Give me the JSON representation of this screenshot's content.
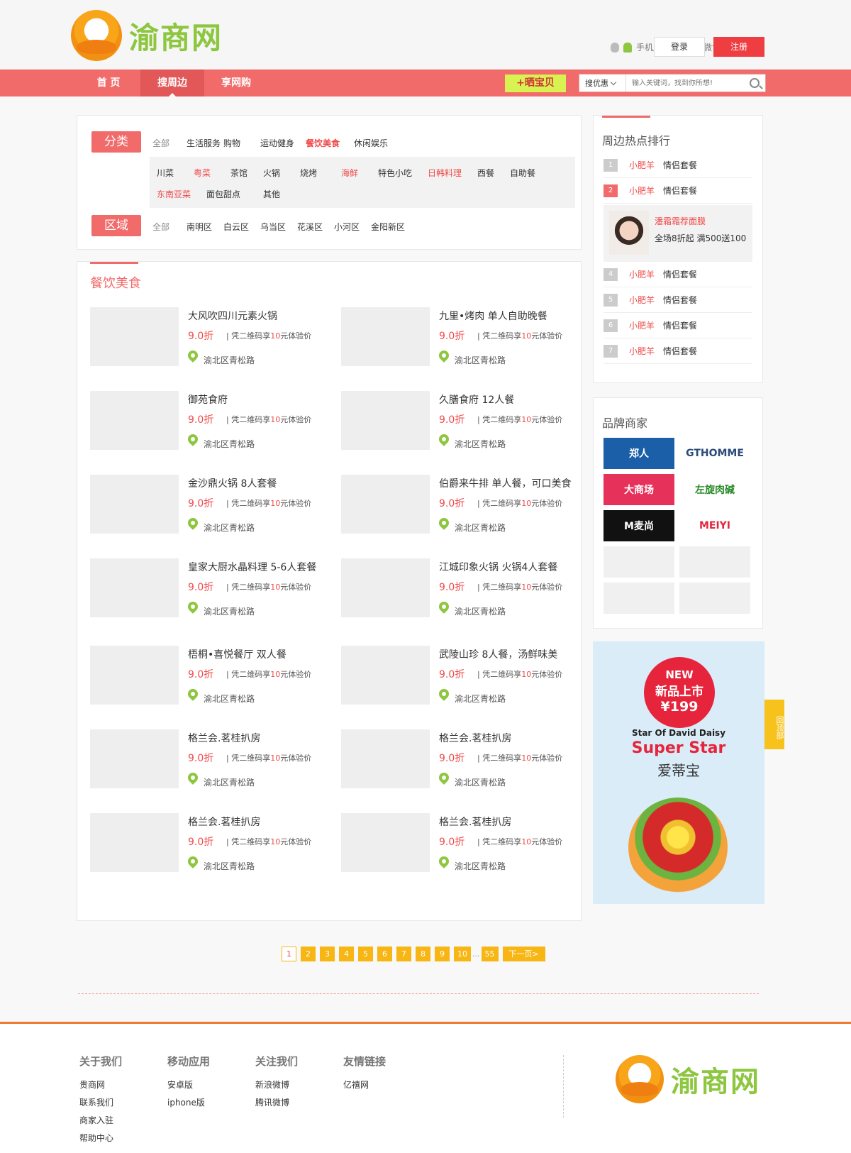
{
  "header": {
    "logo_text": "渝商网",
    "mobile_label": "手机版",
    "weibo_label": "微博登录",
    "login": "登录",
    "register": "注册"
  },
  "nav": {
    "items": [
      "首 页",
      "搜周边",
      "享网购"
    ],
    "active_index": 1,
    "add_button": "+晒宝贝",
    "search_select": "搜优惠",
    "search_placeholder": "输入关键词，找到你所想!"
  },
  "filter": {
    "category_tag": "分类",
    "categories": [
      "全部",
      "生活服务",
      "购物",
      "运动健身",
      "餐饮美食",
      "休闲娱乐"
    ],
    "active_category": "餐饮美食",
    "subcategories_row1": [
      "川菜",
      "粤菜",
      "茶馆",
      "火锅",
      "烧烤",
      "海鲜",
      "特色小吃",
      "日韩料理",
      "西餐",
      "自助餐"
    ],
    "subcategories_row2": [
      "东南亚菜",
      "面包甜点",
      "其他"
    ],
    "highlighted_subs": [
      "粤菜",
      "海鲜",
      "日韩料理",
      "东南亚菜"
    ],
    "region_tag": "区域",
    "regions": [
      "全部",
      "南明区",
      "白云区",
      "乌当区",
      "花溪区",
      "小河区",
      "金阳新区"
    ]
  },
  "deals": {
    "title": "餐饮美食",
    "price": "9.0折",
    "desc_prefix": "| 凭二维码享",
    "desc_num": "10",
    "desc_suffix": "元体验价",
    "location": "渝北区青松路",
    "items": [
      {
        "name": "大风吹四川元素火锅",
        "img": "bbq"
      },
      {
        "name": "九里•烤肉 单人自助晚餐",
        "img": "drink"
      },
      {
        "name": "御苑食府",
        "img": "meat"
      },
      {
        "name": "久膳食府 12人餐",
        "img": "corn"
      },
      {
        "name": "金沙鼎火锅 8人套餐",
        "img": "hotpot"
      },
      {
        "name": "伯爵来牛排 单人餐，可口美食",
        "img": "drink"
      },
      {
        "name": "皇家大厨水晶料理 5-6人套餐",
        "img": "skewer"
      },
      {
        "name": "江城印象火锅 火锅4人套餐",
        "img": "cafe"
      },
      {
        "name": "梧桐•喜悦餐厅 双人餐",
        "img": "pork"
      },
      {
        "name": "武陵山珍 8人餐，汤鲜味美",
        "img": "soup"
      },
      {
        "name": "格兰会.茗桂扒房",
        "img": "meat"
      },
      {
        "name": "格兰会.茗桂扒房",
        "img": "none"
      },
      {
        "name": "格兰会.茗桂扒房",
        "img": "none"
      },
      {
        "name": "格兰会.茗桂扒房",
        "img": "none"
      }
    ]
  },
  "ranking": {
    "title": "周边热点排行",
    "shop": "小肥羊",
    "item": "情侣套餐",
    "rows": [
      "1",
      "2",
      "4",
      "5",
      "6",
      "7"
    ],
    "feature": {
      "title": "潘霜霜荐面膜",
      "sub": "全场8折起  满500送100"
    }
  },
  "brands": {
    "title": "品牌商家",
    "items": [
      {
        "label": "郑人",
        "color": "#1a5fa8"
      },
      {
        "label": "GTHOMME",
        "color": "#2a4a7a"
      },
      {
        "label": "大商场",
        "color": "#e6325a"
      },
      {
        "label": "左旋肉碱",
        "color": "#2a8a2a"
      },
      {
        "label": "M麦尚",
        "color": "#111111"
      },
      {
        "label": "MEIYI",
        "color": "#e6253c"
      }
    ]
  },
  "ad": {
    "badge_1": "NEW",
    "badge_2": "新品上市",
    "badge_3": "¥199",
    "star_text": "Star Of David Daisy",
    "super_text": "Super Star",
    "brand_text": "爱蒂宝"
  },
  "gotop": "回顶部",
  "pagination": {
    "pages": [
      "1",
      "2",
      "3",
      "4",
      "5",
      "6",
      "7",
      "8",
      "9",
      "10"
    ],
    "ellipsis": "...",
    "last": "55",
    "next": "下一页>"
  },
  "footer": {
    "columns": [
      {
        "title": "关于我们",
        "links": [
          "贵商网",
          "联系我们",
          "商家入驻",
          "帮助中心"
        ]
      },
      {
        "title": "移动应用",
        "links": [
          "安卓版",
          "iphone版"
        ]
      },
      {
        "title": "关注我们",
        "links": [
          "新浪微博",
          "腾讯微博"
        ]
      },
      {
        "title": "友情链接",
        "links": [
          "亿禧网"
        ]
      }
    ],
    "logo_text": "渝商网"
  }
}
